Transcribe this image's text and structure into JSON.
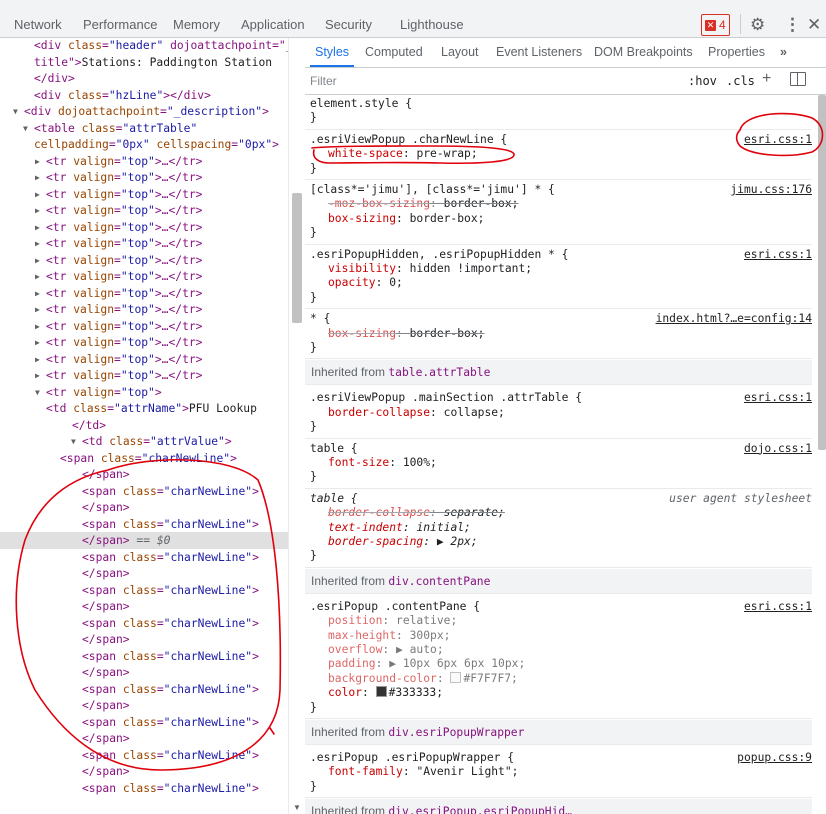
{
  "toolbar": {
    "tabs": [
      "Network",
      "Performance",
      "Memory",
      "Application",
      "Security",
      "Lighthouse"
    ],
    "error_count": "4",
    "settings_icon": "gear-icon",
    "more_icon": "kebab-icon",
    "close_icon": "close-icon"
  },
  "elements": {
    "lines": [
      {
        "t": "tag",
        "text": "<div class=\"header\" dojoattachpoint=\"_"
      },
      {
        "t": "mixed",
        "a": "title\">",
        "b": "Stations: Paddington Station"
      },
      {
        "t": "tag",
        "text": "</div>"
      },
      {
        "t": "tag",
        "text": "<div class=\"hzLine\"></div>"
      },
      {
        "t": "tag",
        "text": "▼<div dojoattachpoint=\"_description\">"
      },
      {
        "t": "tag",
        "text": "▼<table class=\"attrTable\""
      },
      {
        "t": "tag",
        "text": "cellpadding=\"0px\" cellspacing=\"0px\">"
      },
      {
        "t": "tr",
        "text": "▶<tr valign=\"top\">…</tr>"
      },
      {
        "t": "tr",
        "text": "▶<tr valign=\"top\">…</tr>"
      },
      {
        "t": "tr",
        "text": "▶<tr valign=\"top\">…</tr>"
      },
      {
        "t": "tr",
        "text": "▶<tr valign=\"top\">…</tr>"
      },
      {
        "t": "tr",
        "text": "▶<tr valign=\"top\">…</tr>"
      },
      {
        "t": "tr",
        "text": "▶<tr valign=\"top\">…</tr>"
      },
      {
        "t": "tr",
        "text": "▶<tr valign=\"top\">…</tr>"
      },
      {
        "t": "tr",
        "text": "▶<tr valign=\"top\">…</tr>"
      },
      {
        "t": "tr",
        "text": "▶<tr valign=\"top\">…</tr>"
      },
      {
        "t": "tr",
        "text": "▶<tr valign=\"top\">…</tr>"
      },
      {
        "t": "tr",
        "text": "▶<tr valign=\"top\">…</tr>"
      },
      {
        "t": "tr",
        "text": "▶<tr valign=\"top\">…</tr>"
      },
      {
        "t": "tr",
        "text": "▶<tr valign=\"top\">…</tr>"
      },
      {
        "t": "tr",
        "text": "▶<tr valign=\"top\">…</tr>"
      },
      {
        "t": "tag",
        "text": "▼<tr valign=\"top\">"
      },
      {
        "t": "mixed",
        "a": "<td class=\"attrName\">",
        "b": "PFU Lookup"
      },
      {
        "t": "tag",
        "text": "</td>"
      },
      {
        "t": "tag",
        "text": "▼<td class=\"attrValue\">"
      },
      {
        "t": "tag",
        "text": "<span class=\"charNewLine\">"
      },
      {
        "t": "tag",
        "text": "</span>"
      },
      {
        "t": "tag",
        "text": "<span class=\"charNewLine\">"
      },
      {
        "t": "tag",
        "text": "</span>"
      },
      {
        "t": "tag",
        "text": "<span class=\"charNewLine\">"
      },
      {
        "t": "sel",
        "text": "</span>",
        "suffix": " == $0"
      },
      {
        "t": "tag",
        "text": "<span class=\"charNewLine\">"
      },
      {
        "t": "tag",
        "text": "</span>"
      },
      {
        "t": "tag",
        "text": "<span class=\"charNewLine\">"
      },
      {
        "t": "tag",
        "text": "</span>"
      },
      {
        "t": "tag",
        "text": "<span class=\"charNewLine\">"
      },
      {
        "t": "tag",
        "text": "</span>"
      },
      {
        "t": "tag",
        "text": "<span class=\"charNewLine\">"
      },
      {
        "t": "tag",
        "text": "</span>"
      },
      {
        "t": "tag",
        "text": "<span class=\"charNewLine\">"
      },
      {
        "t": "tag",
        "text": "</span>"
      },
      {
        "t": "tag",
        "text": "<span class=\"charNewLine\">"
      },
      {
        "t": "tag",
        "text": "</span>"
      },
      {
        "t": "tag",
        "text": "<span class=\"charNewLine\">"
      },
      {
        "t": "tag",
        "text": "</span>"
      },
      {
        "t": "tag",
        "text": "<span class=\"charNewLine\">"
      }
    ]
  },
  "styles": {
    "tabs": [
      "Styles",
      "Computed",
      "Layout",
      "Event Listeners",
      "DOM Breakpoints",
      "Properties",
      "»"
    ],
    "filter_placeholder": "Filter",
    "hov": ":hov",
    "cls": ".cls",
    "rules": [
      {
        "kind": "rule",
        "sel": "element.style {",
        "src": "",
        "decls": [],
        "close": "}"
      },
      {
        "kind": "rule",
        "sel": ".esriViewPopup .charNewLine {",
        "src": "esri.css:1",
        "decls": [
          {
            "p": "white-space",
            "v": "pre-wrap;"
          }
        ],
        "close": "}"
      },
      {
        "kind": "rule",
        "sel": "[class*='jimu'], [class*='jimu'] * {",
        "src": "jimu.css:176",
        "decls": [
          {
            "p": "-moz-box-sizing",
            "v": "border-box;",
            "strike": true
          },
          {
            "p": "box-sizing",
            "v": "border-box;"
          }
        ],
        "close": "}"
      },
      {
        "kind": "rule",
        "sel": ".esriPopupHidden, .esriPopupHidden * {",
        "src": "esri.css:1",
        "decls": [
          {
            "p": "visibility",
            "v": "hidden !important;"
          },
          {
            "p": "opacity",
            "v": "0;"
          }
        ],
        "close": "}"
      },
      {
        "kind": "rule",
        "sel": "* {",
        "src": "index.html?…e=config:14",
        "decls": [
          {
            "p": "box-sizing",
            "v": "border-box;",
            "strike": true
          }
        ],
        "close": "}"
      },
      {
        "kind": "inh",
        "label": "Inherited from",
        "link": "table.attrTable"
      },
      {
        "kind": "rule",
        "sel": ".esriViewPopup .mainSection .attrTable {",
        "src": "esri.css:1",
        "decls": [
          {
            "p": "border-collapse",
            "v": "collapse;"
          }
        ],
        "close": "}"
      },
      {
        "kind": "rule",
        "sel": "table {",
        "src": "dojo.css:1",
        "decls": [
          {
            "p": "font-size",
            "v": "100%;"
          }
        ],
        "close": "}"
      },
      {
        "kind": "rule",
        "sel": "table {",
        "src": "user agent stylesheet",
        "ua": true,
        "decls": [
          {
            "p": "border-collapse",
            "v": "separate;",
            "strike": true
          },
          {
            "p": "text-indent",
            "v": "initial;"
          },
          {
            "p": "border-spacing",
            "v": "▶ 2px;"
          }
        ],
        "close": "}"
      },
      {
        "kind": "inh",
        "label": "Inherited from",
        "link": "div.contentPane"
      },
      {
        "kind": "rule",
        "sel": ".esriPopup .contentPane {",
        "src": "esri.css:1",
        "dimmed": true,
        "decls": [
          {
            "p": "position",
            "v": "relative;"
          },
          {
            "p": "max-height",
            "v": "300px;"
          },
          {
            "p": "overflow",
            "v": "▶ auto;"
          },
          {
            "p": "padding",
            "v": "▶ 10px 6px 6px 10px;"
          },
          {
            "p": "background-color",
            "v": "#F7F7F7;",
            "swatch": "#F7F7F7"
          },
          {
            "p": "color",
            "v": "#333333;",
            "swatch": "#333333",
            "active": true
          }
        ],
        "close": "}"
      },
      {
        "kind": "inh",
        "label": "Inherited from",
        "link": "div.esriPopupWrapper"
      },
      {
        "kind": "rule",
        "sel": ".esriPopup .esriPopupWrapper {",
        "src": "popup.css:9",
        "decls": [
          {
            "p": "font-family",
            "v": "\"Avenir Light\";",
            "active": true
          }
        ],
        "close": "}"
      },
      {
        "kind": "inh",
        "label": "Inherited from",
        "link": "div.esriPopup.esriPopupHid…"
      }
    ]
  }
}
